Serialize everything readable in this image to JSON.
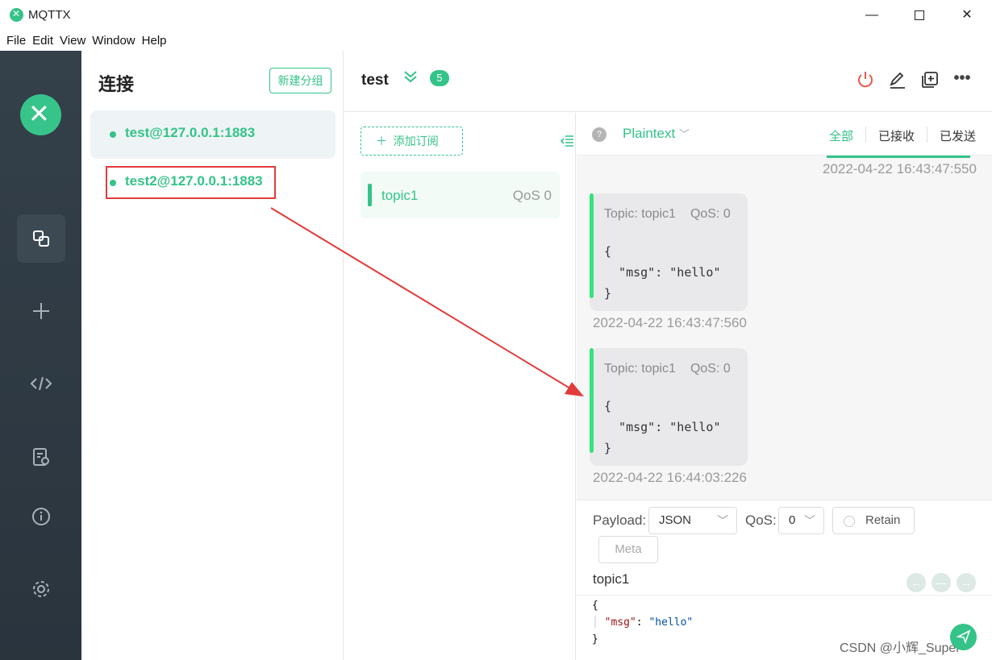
{
  "window": {
    "app_title": "MQTTX",
    "minimize": "—",
    "close": "✕"
  },
  "menu": [
    "File",
    "Edit",
    "View",
    "Window",
    "Help"
  ],
  "connections": {
    "title": "连接",
    "new_group_label": "新建分组",
    "items": [
      {
        "label": "test@127.0.0.1:1883"
      },
      {
        "label": "test2@127.0.0.1:1883"
      }
    ]
  },
  "header": {
    "connection_name": "test",
    "count": "5"
  },
  "subscriptions": {
    "add_label": "添加订阅",
    "items": [
      {
        "topic": "topic1",
        "qos": "QoS 0"
      }
    ]
  },
  "messages": {
    "format": "Plaintext",
    "filters": [
      "全部",
      "已接收",
      "已发送"
    ],
    "list": [
      {
        "time": "2022-04-22 16:43:47:550"
      },
      {
        "topic": "Topic: topic1",
        "qos": "QoS: 0",
        "body": "{\n  \"msg\": \"hello\"\n}",
        "time": "2022-04-22 16:43:47:560"
      },
      {
        "topic": "Topic: topic1",
        "qos": "QoS: 0",
        "body": "{\n  \"msg\": \"hello\"\n}",
        "time": "2022-04-22 16:44:03:226"
      }
    ]
  },
  "compose": {
    "payload_label": "Payload:",
    "payload_format": "JSON",
    "qos_label": "QoS:",
    "qos_value": "0",
    "retain_label": "Retain",
    "meta_label": "Meta",
    "topic": "topic1",
    "payload_key": "\"msg\"",
    "payload_value": "\"hello\""
  },
  "watermark": "CSDN @小辉_Super",
  "colors": {
    "accent": "#34c388",
    "annotation": "#e23b3b",
    "nav_bg": "#2f3a44"
  }
}
